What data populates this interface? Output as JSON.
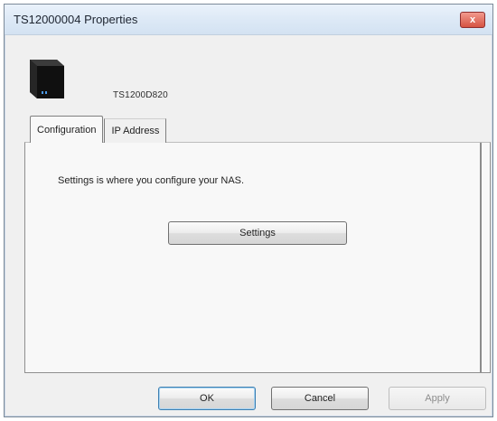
{
  "window": {
    "title": "TS12000004 Properties",
    "close_glyph": "x"
  },
  "device": {
    "icon_name": "nas-device-icon",
    "name": "TS1200D820"
  },
  "tabs": [
    {
      "label": "Configuration",
      "active": true
    },
    {
      "label": "IP Address",
      "active": false
    }
  ],
  "panel": {
    "description": "Settings is where you configure your NAS.",
    "settings_label": "Settings"
  },
  "buttons": {
    "ok": "OK",
    "cancel": "Cancel",
    "apply": "Apply"
  },
  "colors": {
    "title_bar": "#dde9f6",
    "close_button": "#d55342",
    "window_bg": "#f0f0f0",
    "default_button_border": "#3c7fb1"
  }
}
